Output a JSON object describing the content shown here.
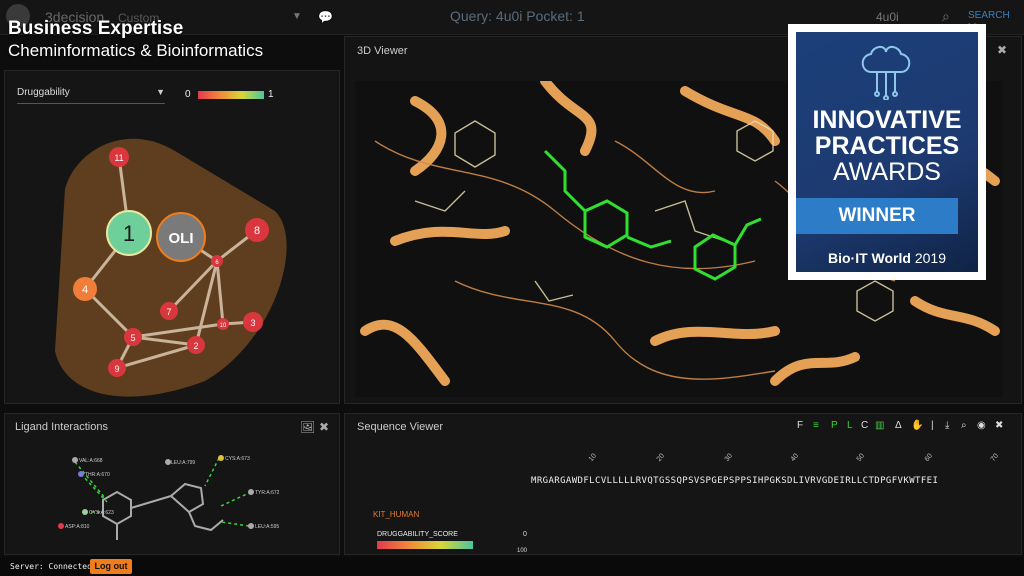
{
  "topbar": {
    "brand": "3decision",
    "custom": "Custom",
    "query": "Query: 4u0i Pocket: 1",
    "search_value": "4u0i",
    "search_link": "SEARCH >>"
  },
  "overlay": {
    "title": "Business Expertise",
    "subtitle": "Cheminformatics & Bioinformatics"
  },
  "left_panel": {
    "select_value": "Druggability",
    "scale_min": "0",
    "scale_max": "1",
    "nodes": {
      "n1": "1",
      "oli": "OLI",
      "n2": "2",
      "n3": "3",
      "n4": "4",
      "n5": "5",
      "n6": "6",
      "n7": "7",
      "n8": "8",
      "n9": "9",
      "n10": "10",
      "n11": "11"
    }
  },
  "viewer": {
    "title": "3D Viewer"
  },
  "ligand": {
    "title": "Ligand Interactions",
    "labels": [
      "VAL:A:668",
      "THR:A:670",
      "CYS:A:673",
      "LEU:A:799",
      "TYR:A:672",
      "LEU:A:595",
      "CYS:A:623",
      "ASP:A:810"
    ]
  },
  "sequence": {
    "title": "Sequence Viewer",
    "tools": [
      "F",
      "P",
      "L",
      "C",
      "Δ"
    ],
    "letters": "MRGARGAWDFLCVLLLLLRVQTGSSQPSVSPGEPSPPSIHPGKSDLIVRVGDEIRLLCTDPGFVKWTFEI",
    "ticks": [
      "10",
      "20",
      "30",
      "40",
      "50",
      "60",
      "70"
    ],
    "track": "KIT_HUMAN",
    "score_label": "DRUGGABILITY_SCORE",
    "score_min": "0",
    "score_max": "100"
  },
  "status": {
    "server": "Server: Connected",
    "logout": "Log out"
  },
  "award": {
    "line1": "INNOVATIVE",
    "line2": "PRACTICES",
    "line3": "AWARDS",
    "winner": "WINNER",
    "bio": "Bio·IT World",
    "year": "2019"
  }
}
